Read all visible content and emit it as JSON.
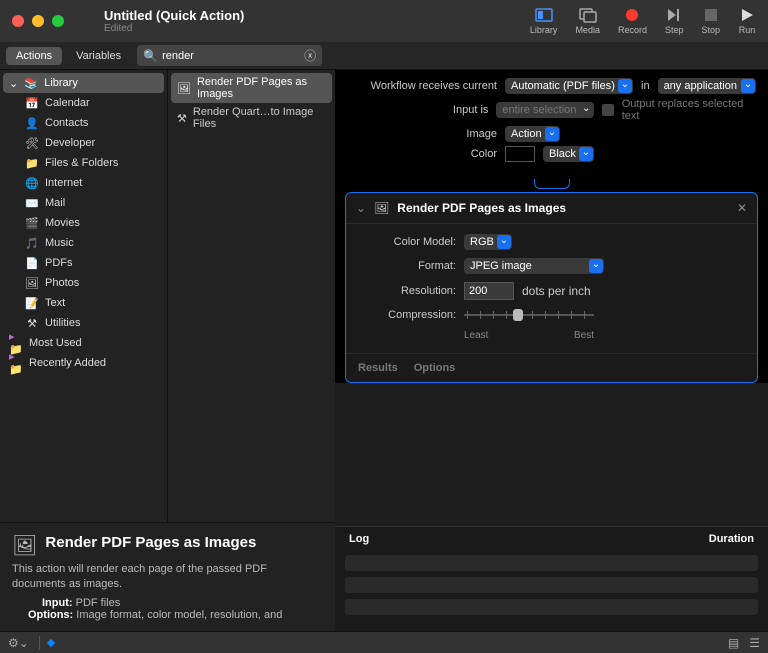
{
  "title": {
    "main": "Untitled (Quick Action)",
    "sub": "Edited"
  },
  "toolbar": {
    "library": "Library",
    "media": "Media",
    "record": "Record",
    "step": "Step",
    "stop": "Stop",
    "run": "Run"
  },
  "tabs": {
    "actions": "Actions",
    "variables": "Variables"
  },
  "search": {
    "placeholder": "Search",
    "value": "render"
  },
  "library": {
    "header": "Library",
    "items": [
      {
        "icon": "📅",
        "label": "Calendar"
      },
      {
        "icon": "👤",
        "label": "Contacts"
      },
      {
        "icon": "🛠",
        "label": "Developer"
      },
      {
        "icon": "📁",
        "label": "Files & Folders"
      },
      {
        "icon": "🌐",
        "label": "Internet"
      },
      {
        "icon": "✉️",
        "label": "Mail"
      },
      {
        "icon": "🎬",
        "label": "Movies"
      },
      {
        "icon": "🎵",
        "label": "Music"
      },
      {
        "icon": "📄",
        "label": "PDFs"
      },
      {
        "icon": "🖼",
        "label": "Photos"
      },
      {
        "icon": "📝",
        "label": "Text"
      },
      {
        "icon": "⚒",
        "label": "Utilities"
      }
    ],
    "smart": [
      {
        "icon": "📂",
        "label": "Most Used",
        "color": "#b76bd6"
      },
      {
        "icon": "📂",
        "label": "Recently Added",
        "color": "#b76bd6"
      }
    ]
  },
  "results": [
    {
      "label": "Render PDF Pages as Images"
    },
    {
      "label": "Render Quart…to Image Files"
    }
  ],
  "cfg": {
    "receives_label": "Workflow receives current",
    "receives_value": "Automatic (PDF files)",
    "in_label": "in",
    "in_value": "any application",
    "inputis_label": "Input is",
    "inputis_value": "entire selection",
    "output_replaces": "Output replaces selected text",
    "image_label": "Image",
    "image_value": "Action",
    "color_label": "Color",
    "color_value": "Black"
  },
  "action": {
    "title": "Render PDF Pages as Images",
    "color_model_label": "Color Model:",
    "color_model_value": "RGB",
    "format_label": "Format:",
    "format_value": "JPEG image",
    "resolution_label": "Resolution:",
    "resolution_value": "200",
    "resolution_unit": "dots per inch",
    "compression_label": "Compression:",
    "least": "Least",
    "best": "Best",
    "results": "Results",
    "options": "Options"
  },
  "log": {
    "log": "Log",
    "duration": "Duration"
  },
  "info": {
    "title": "Render PDF Pages as Images",
    "desc": "This action will render each page of the passed PDF documents as images.",
    "input_label": "Input:",
    "input_value": "PDF files",
    "options_label": "Options:",
    "options_value": "Image format, color model, resolution, and"
  }
}
